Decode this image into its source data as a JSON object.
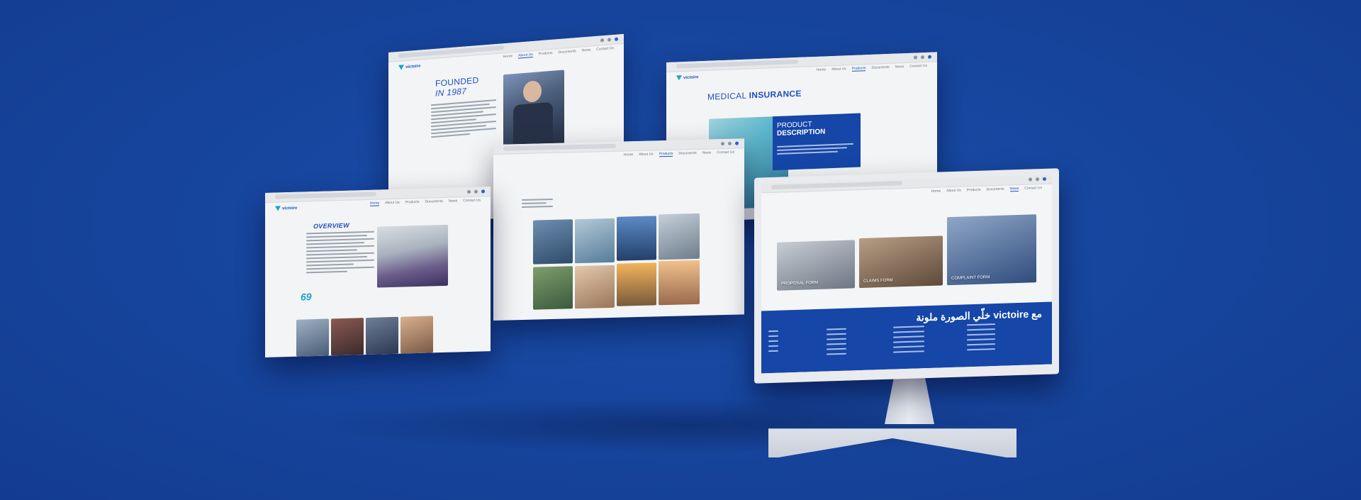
{
  "nav": [
    "Home",
    "About Us",
    "Products",
    "Documents",
    "News",
    "Contact Us"
  ],
  "founded": {
    "heading_line1": "FOUNDED",
    "heading_line2": "IN 1987"
  },
  "medical": {
    "heading_light": "MEDICAL",
    "heading_bold": "INSURANCE",
    "product_light": "PRODUCT",
    "product_bold": "DESCRIPTION"
  },
  "overview": {
    "heading": "OVERVIEW",
    "stat": "69"
  },
  "forms": {
    "tile1": "PROPOSAL FORM",
    "tile2": "CLAIMS FORM",
    "tile3": "COMPLAINT FORM"
  },
  "footer": {
    "tagline": "مع victoire خلّي الصورة ملونة"
  },
  "colors": {
    "background": "#17469f",
    "brand_blue": "#1d4fbf",
    "footer_blue": "#1546a8",
    "accent_teal": "#1aa3c8",
    "whatsapp": "#25c15c"
  }
}
